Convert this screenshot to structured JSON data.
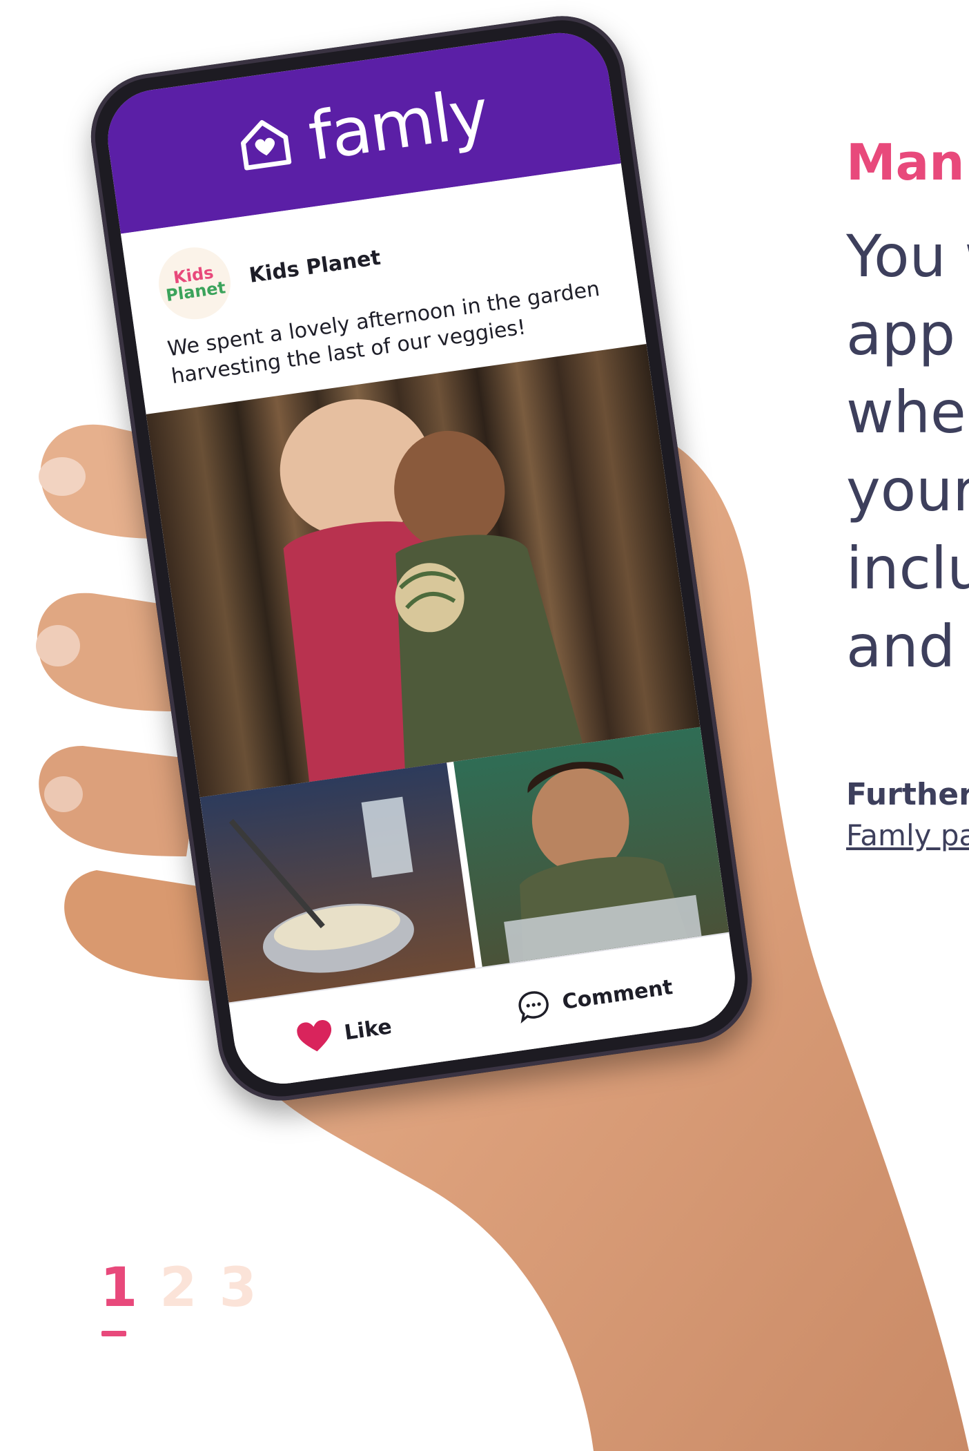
{
  "app": {
    "logo_text": "famly",
    "post": {
      "author": "Kids Planet",
      "avatar_line1": "Kids",
      "avatar_line2": "Planet",
      "caption": "We spent a lovely afternoon in the garden harvesting the last of our veggies!"
    },
    "actions": {
      "like_label": "Like",
      "comment_label": "Comment"
    }
  },
  "copy": {
    "heading": "Man",
    "body_lines": [
      "You w",
      "app",
      "when",
      "your",
      "inclu",
      "and r"
    ],
    "further_label": "Further",
    "link_label": "Famly pa"
  },
  "pager": {
    "pages": [
      "1",
      "2",
      "3"
    ],
    "active": "1"
  },
  "colors": {
    "brand_purple": "#5b1fa6",
    "accent_pink": "#e8497b",
    "text_dark": "#3d3f5c",
    "inactive_page": "#fbe3d8"
  },
  "icons": {
    "logo": "house-heart-icon",
    "like": "heart-icon",
    "comment": "speech-bubble-icon"
  }
}
